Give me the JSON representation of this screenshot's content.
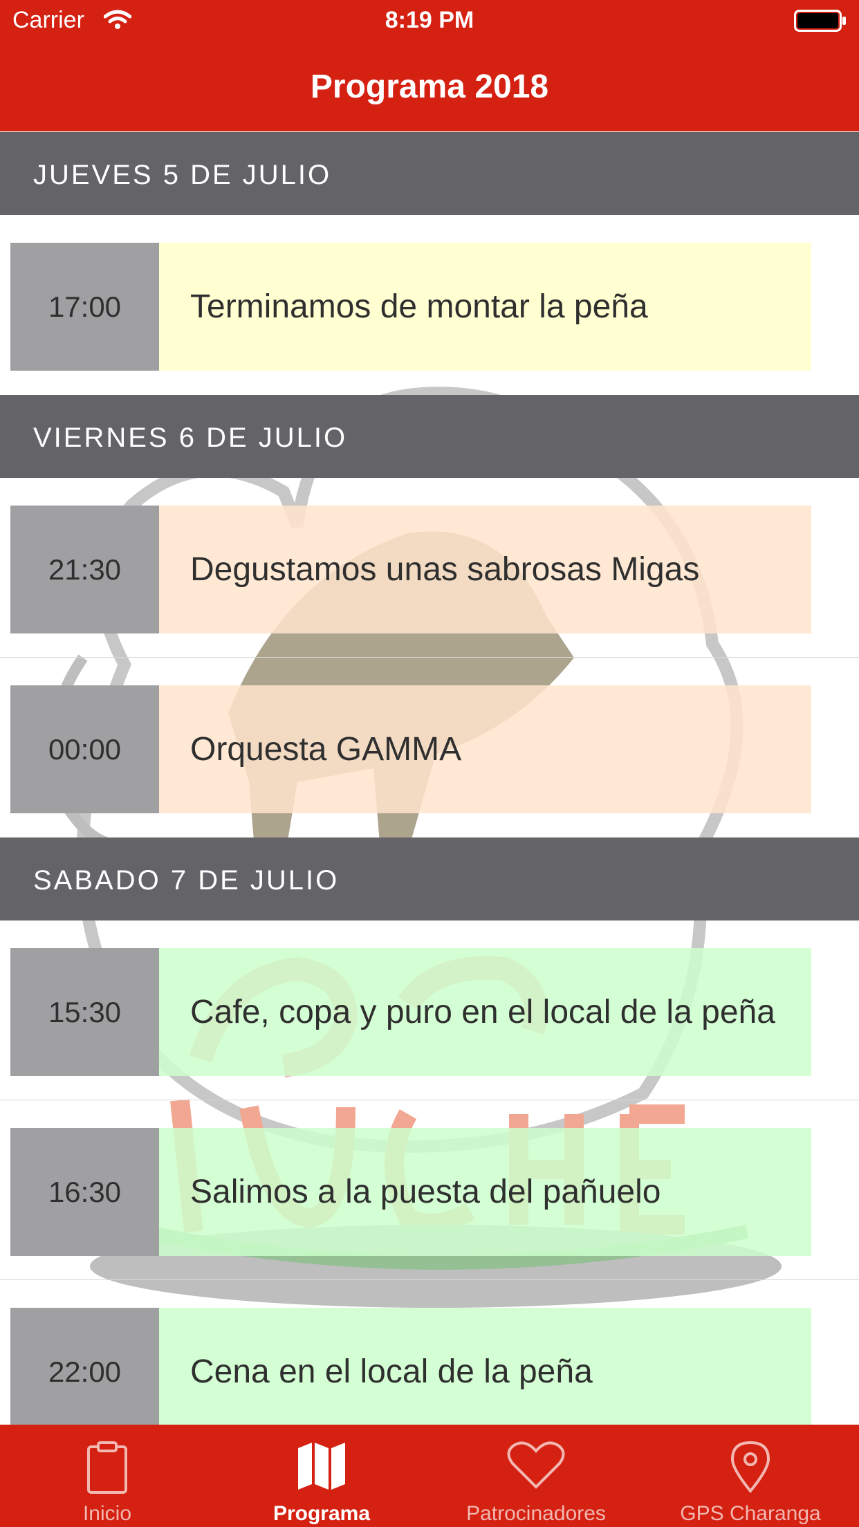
{
  "status_bar": {
    "carrier": "Carrier",
    "time": "8:19 PM"
  },
  "nav": {
    "title": "Programa 2018"
  },
  "colors": {
    "brand_red": "#d42112",
    "section_gray": "#636368",
    "time_gray": "#a0a0a2",
    "yellow": "#ffffcc",
    "orange": "#ffe5cc",
    "green": "#ccffcc"
  },
  "sections": [
    {
      "title": "JUEVES 5 DE JULIO",
      "events": [
        {
          "time": "17:00",
          "text": "Terminamos de montar la peña",
          "color": "#ffffcc"
        }
      ]
    },
    {
      "title": "VIERNES 6 DE JULIO",
      "events": [
        {
          "time": "21:30",
          "text": "Degustamos unas sabrosas Migas",
          "color": "#ffe5cc"
        },
        {
          "time": "00:00",
          "text": "Orquesta GAMMA",
          "color": "#ffe5cc"
        }
      ]
    },
    {
      "title": "SABADO 7 DE JULIO",
      "events": [
        {
          "time": "15:30",
          "text": "Cafe, copa y puro en el local de la peña",
          "color": "#ccffcc"
        },
        {
          "time": "16:30",
          "text": "Salimos a la puesta del pañuelo",
          "color": "#ccffcc"
        },
        {
          "time": "22:00",
          "text": "Cena en el local de la peña",
          "color": "#ccffcc"
        }
      ]
    }
  ],
  "tabs": [
    {
      "label": "Inicio",
      "icon": "clipboard-icon",
      "active": false
    },
    {
      "label": "Programa",
      "icon": "map-icon",
      "active": true
    },
    {
      "label": "Patrocinadores",
      "icon": "heart-icon",
      "active": false
    },
    {
      "label": "GPS Charanga",
      "icon": "location-pin-icon",
      "active": false
    }
  ]
}
